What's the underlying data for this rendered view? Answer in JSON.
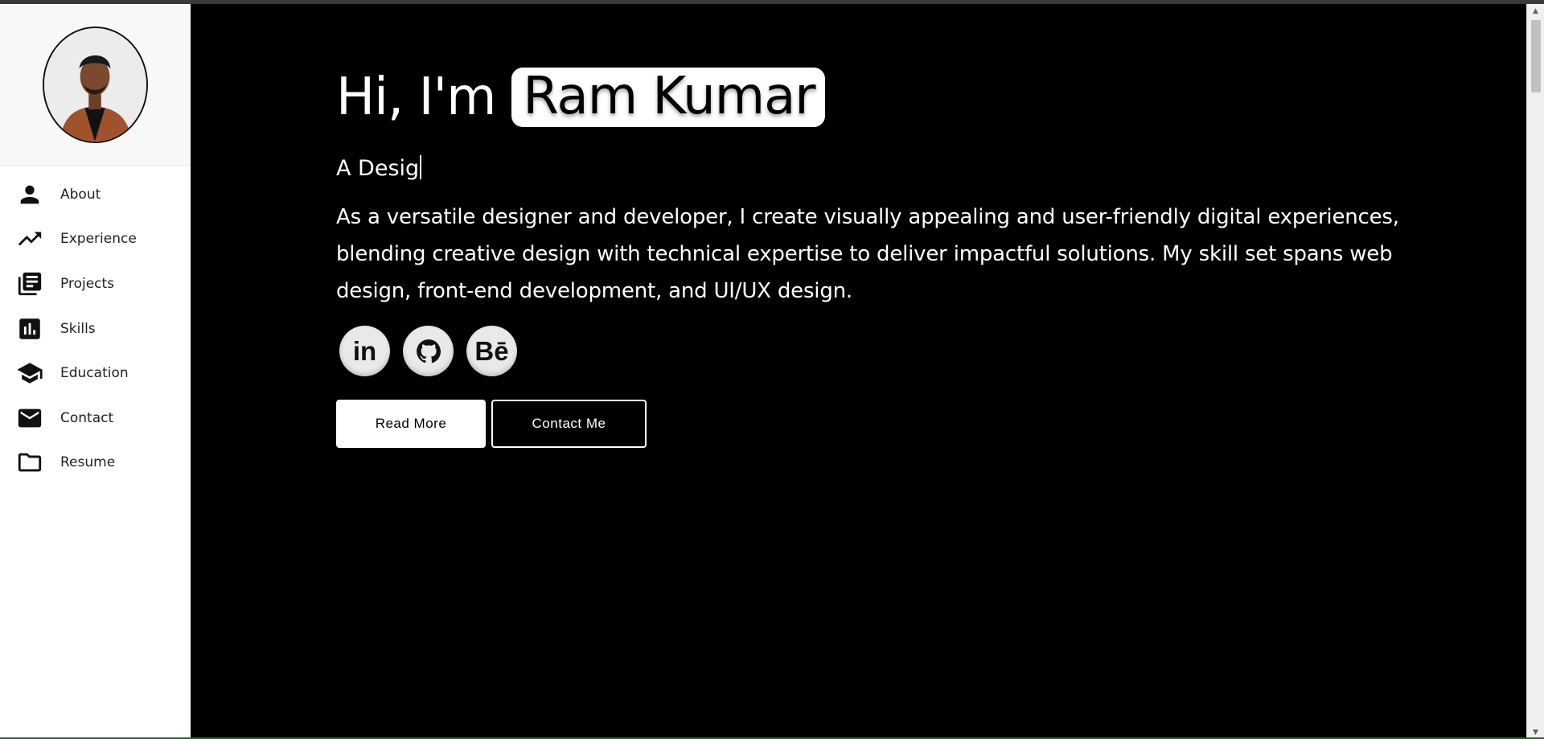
{
  "sidebar": {
    "avatar_alt": "Profile photo",
    "items": [
      {
        "label": "About",
        "icon": "person-icon"
      },
      {
        "label": "Experience",
        "icon": "trending-up-icon"
      },
      {
        "label": "Projects",
        "icon": "library-books-icon"
      },
      {
        "label": "Skills",
        "icon": "bar-chart-icon"
      },
      {
        "label": "Education",
        "icon": "graduation-cap-icon"
      },
      {
        "label": "Contact",
        "icon": "mail-icon"
      },
      {
        "label": "Resume",
        "icon": "folder-icon"
      }
    ]
  },
  "hero": {
    "greeting": "Hi, I'm",
    "name": "Ram Kumar",
    "typed_text": "A Desig",
    "bio": "As a versatile designer and developer, I create visually appealing and user-friendly digital experiences, blending creative design with technical expertise to deliver impactful solutions. My skill set spans web design, front-end development, and UI/UX design.",
    "socials": [
      {
        "label": "in",
        "icon": "linkedin-icon"
      },
      {
        "label": "",
        "icon": "github-icon"
      },
      {
        "label": "Bē",
        "icon": "behance-icon"
      }
    ],
    "read_more": "Read More",
    "contact_me": "Contact Me"
  },
  "colors": {
    "main_bg": "#000000",
    "sidebar_bg": "#ffffff",
    "accent": "#ffffff"
  }
}
